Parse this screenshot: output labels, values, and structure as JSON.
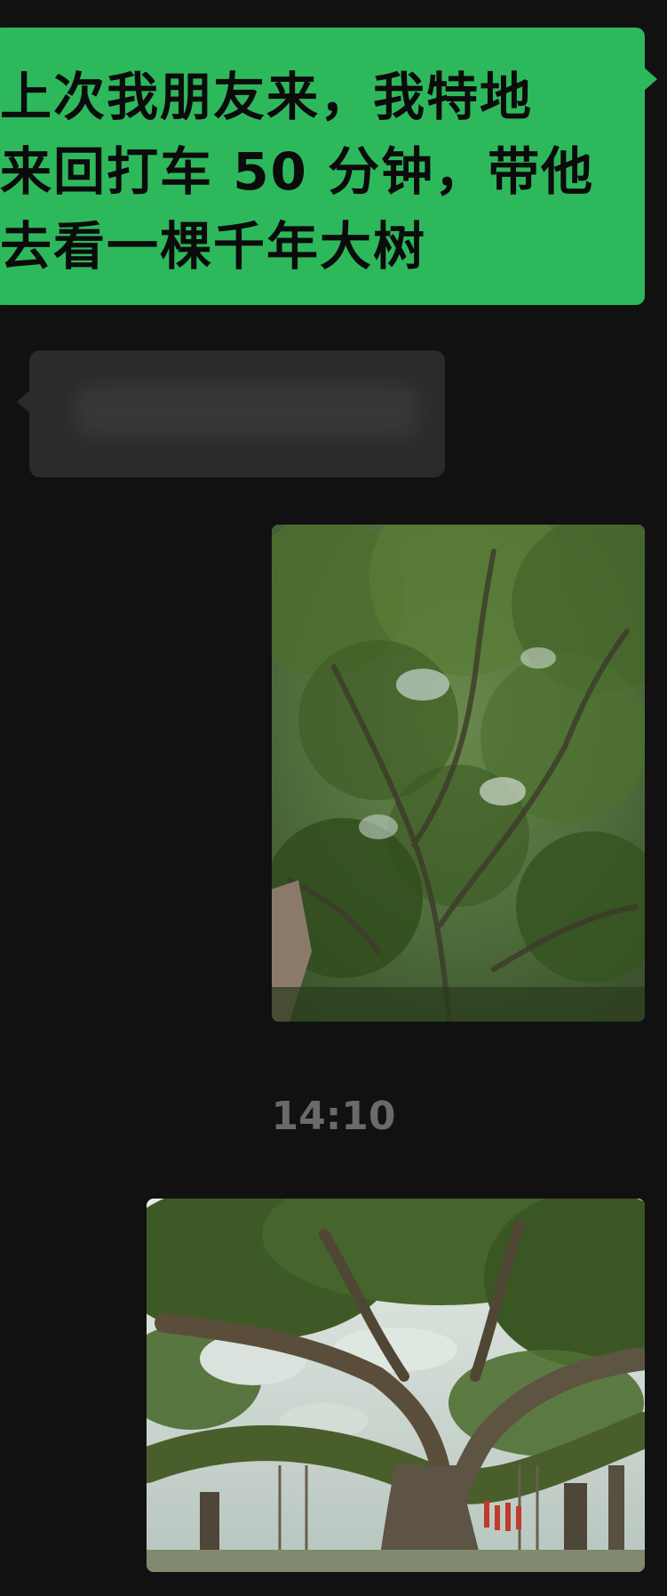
{
  "messages": [
    {
      "direction": "outgoing",
      "type": "text",
      "lines": [
        "上次我朋友来，我特地",
        "来回打车 50 分钟，带他",
        "去看一棵千年大树"
      ]
    },
    {
      "direction": "incoming",
      "type": "text",
      "blurred": true
    },
    {
      "direction": "outgoing",
      "type": "image",
      "icon": "tree-canopy-photo"
    },
    {
      "direction": "outgoing",
      "type": "image",
      "icon": "giant-banyan-tree-photo"
    }
  ],
  "timestamp": "14:10",
  "colors": {
    "background": "#111111",
    "outgoing_bubble": "#2eb85c",
    "incoming_bubble": "#2b2b2b",
    "timestamp_text": "#6a6a6a"
  }
}
